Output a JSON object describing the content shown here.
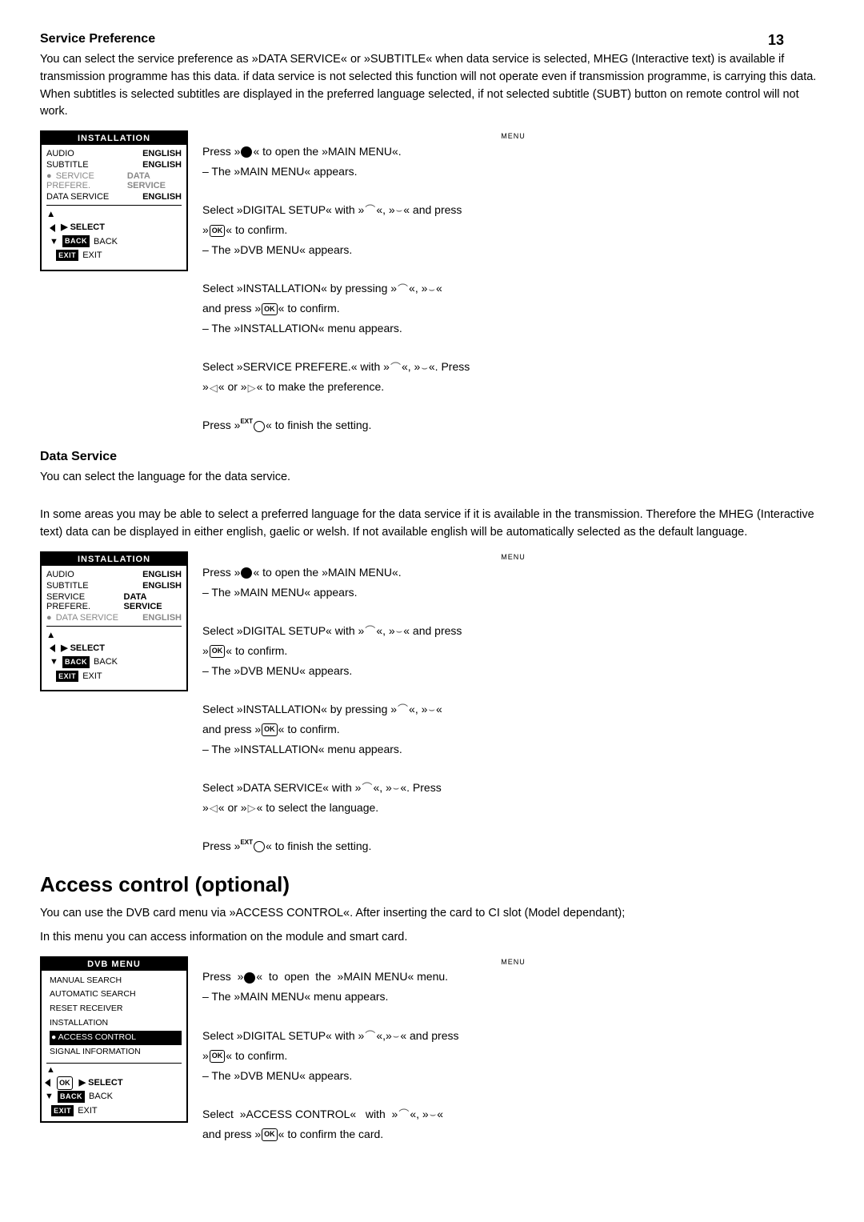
{
  "page": {
    "number": "13",
    "sections": [
      {
        "id": "service-preference",
        "title": "Service Preference",
        "intro": "You can select the service preference as »DATA SERVICE« or »SUBTITLE« when data service is selected, MHEG (Interactive text) is available if transmission programme has this data. if data service is not selected this function will not operate even if transmission programme, is carrying this data. When subtitles is selected subtitles are displayed in the preferred language selected, if not selected subtitle (SUBT) button on remote control will not work.",
        "menu": {
          "title": "INSTALLATION",
          "rows": [
            {
              "label": "AUDIO",
              "value": "ENGLISH",
              "highlighted": false,
              "dot": false
            },
            {
              "label": "SUBTITLE",
              "value": "ENGLISH",
              "highlighted": false,
              "dot": false
            },
            {
              "label": "SERVICE PREFERE.",
              "value": "DATA SERVICE",
              "highlighted": true,
              "dot": true
            },
            {
              "label": "DATA SERVICE",
              "value": "ENGLISH",
              "highlighted": false,
              "dot": false
            }
          ]
        },
        "instructions": [
          {
            "type": "menu-label",
            "text": "MENU"
          },
          {
            "type": "text",
            "text": "Press »● « to open the »MAIN MENU«."
          },
          {
            "type": "text",
            "text": "– The »MAIN MENU« appears."
          },
          {
            "type": "blank"
          },
          {
            "type": "text",
            "text": "Select »DIGITAL SETUP« with »▲«,»▼« and press"
          },
          {
            "type": "text",
            "text": "»OK« to confirm."
          },
          {
            "type": "text",
            "text": "– The »DVB MENU« appears."
          },
          {
            "type": "blank"
          },
          {
            "type": "text",
            "text": "Select »INSTALLATION« by pressing »▲«,»▼«"
          },
          {
            "type": "text",
            "text": "and press »OK« to confirm."
          },
          {
            "type": "text",
            "text": "– The »INSTALLATION« menu appears."
          },
          {
            "type": "blank"
          },
          {
            "type": "text",
            "text": "Select »SERVICE PREFERE.« with »▲«,»▼«. Press"
          },
          {
            "type": "text",
            "text": "»◄« or »►« to make the preference."
          },
          {
            "type": "blank"
          },
          {
            "type": "text",
            "text": "Press »EXIT« to finish the setting."
          }
        ]
      },
      {
        "id": "data-service",
        "title": "Data Service",
        "intro": "You can select the language for the data service.",
        "intro2": "In some areas you may be able to select a preferred language for the data service if it is available in the transmission. Therefore the MHEG (Interactive text) data can be displayed in either english, gaelic or welsh. If not available english will be automatically selected as the default language.",
        "menu": {
          "title": "INSTALLATION",
          "rows": [
            {
              "label": "AUDIO",
              "value": "ENGLISH",
              "highlighted": false,
              "dot": false
            },
            {
              "label": "SUBTITLE",
              "value": "ENGLISH",
              "highlighted": false,
              "dot": false
            },
            {
              "label": "SERVICE PREFERE.",
              "value": "DATA SERVICE",
              "highlighted": false,
              "dot": false
            },
            {
              "label": "DATA SERVICE",
              "value": "ENGLISH",
              "highlighted": true,
              "dot": true
            }
          ]
        },
        "instructions": [
          {
            "type": "menu-label",
            "text": "MENU"
          },
          {
            "type": "text",
            "text": "Press »● « to open the »MAIN MENU«."
          },
          {
            "type": "text",
            "text": "– The »MAIN MENU« appears."
          },
          {
            "type": "blank"
          },
          {
            "type": "text",
            "text": "Select »DIGITAL SETUP« with »▲«,»▼« and press"
          },
          {
            "type": "text",
            "text": "»OK« to confirm."
          },
          {
            "type": "text",
            "text": "– The »DVB MENU« appears."
          },
          {
            "type": "blank"
          },
          {
            "type": "text",
            "text": "Select »INSTALLATION« by pressing »▲«,»▼«"
          },
          {
            "type": "text",
            "text": "and press »OK« to confirm."
          },
          {
            "type": "text",
            "text": "– The »INSTALLATION« menu appears."
          },
          {
            "type": "blank"
          },
          {
            "type": "text",
            "text": "Select »DATA SERVICE« with »▲«,»▼«. Press"
          },
          {
            "type": "text",
            "text": "»◄« or »►« to select the language."
          },
          {
            "type": "blank"
          },
          {
            "type": "text",
            "text": "Press »EXIT« to finish the setting."
          }
        ]
      },
      {
        "id": "access-control",
        "title": "Access control (optional)",
        "intro": "You can use the DVB card menu via »ACCESS CONTROL«. After inserting the card to CI slot (Model dependant);",
        "intro2": "In this menu you can access information on the module and smart card.",
        "menu": {
          "title": "DVB MENU",
          "rows": [
            {
              "label": "MANUAL SEARCH",
              "value": "",
              "highlighted": false,
              "dot": false
            },
            {
              "label": "AUTOMATIC SEARCH",
              "value": "",
              "highlighted": false,
              "dot": false
            },
            {
              "label": "RESET RECEIVER",
              "value": "",
              "highlighted": false,
              "dot": false
            },
            {
              "label": "INSTALLATION",
              "value": "",
              "highlighted": false,
              "dot": false
            },
            {
              "label": "ACCESS CONTROL",
              "value": "",
              "highlighted": true,
              "dot": true
            },
            {
              "label": "SIGNAL INFORMATION",
              "value": "",
              "highlighted": false,
              "dot": false
            }
          ]
        },
        "instructions": [
          {
            "type": "menu-label",
            "text": "MENU"
          },
          {
            "type": "text",
            "text": "Press »● « to open the »MAIN MENU« menu."
          },
          {
            "type": "text",
            "text": "– The »MAIN MENU« menu appears."
          },
          {
            "type": "blank"
          },
          {
            "type": "text",
            "text": "Select »DIGITAL SETUP« with »▲«,»▼« and press"
          },
          {
            "type": "text",
            "text": "»OK« to confirm."
          },
          {
            "type": "text",
            "text": "– The »DVB MENU« appears."
          },
          {
            "type": "blank"
          },
          {
            "type": "text",
            "text": "Select »ACCESS CONTROL« with »▲«,»▼«"
          },
          {
            "type": "text",
            "text": "and press »OK« to confirm the card."
          }
        ]
      }
    ]
  }
}
